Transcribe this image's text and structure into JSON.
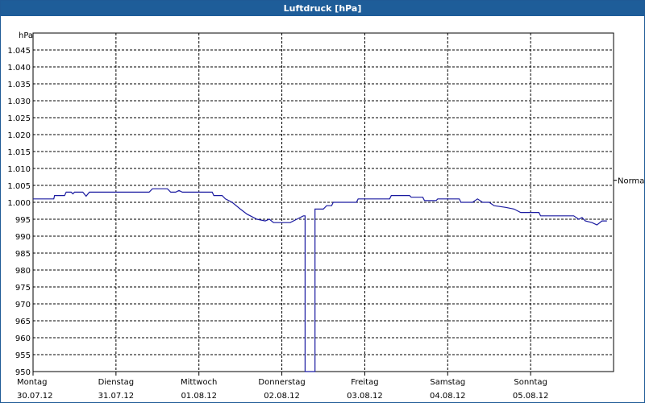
{
  "window": {
    "title": "Luftdruck [hPa]"
  },
  "chart_data": {
    "type": "line",
    "title": "Luftdruck [hPa]",
    "ylabel": "hPa",
    "ylim": [
      950,
      1050
    ],
    "yticks": [
      950,
      955,
      960,
      965,
      970,
      975,
      980,
      985,
      990,
      995,
      1000,
      1005,
      1010,
      1015,
      1020,
      1025,
      1030,
      1035,
      1040,
      1045
    ],
    "ytick_labels": [
      "950",
      "955",
      "960",
      "965",
      "970",
      "975",
      "980",
      "985",
      "990",
      "995",
      "1.000",
      "1.005",
      "1.010",
      "1.015",
      "1.020",
      "1.025",
      "1.030",
      "1.035",
      "1.040",
      "1.045"
    ],
    "xlim": [
      0,
      7
    ],
    "xticks": [
      0,
      1,
      2,
      3,
      4,
      5,
      6,
      7
    ],
    "xtick_labels": [
      {
        "day": "Montag",
        "date": "30.07.12"
      },
      {
        "day": "Dienstag",
        "date": "31.07.12"
      },
      {
        "day": "Mittwoch",
        "date": "01.08.12"
      },
      {
        "day": "Donnerstag",
        "date": "02.08.12"
      },
      {
        "day": "Freitag",
        "date": "03.08.12"
      },
      {
        "day": "Samstag",
        "date": "04.08.12"
      },
      {
        "day": "Sonntag",
        "date": "05.08.12"
      }
    ],
    "reference_line": {
      "label": "Normal",
      "value": 1006.5
    },
    "grid": true,
    "series": [
      {
        "color": "#1a1aa0",
        "points": [
          [
            0.0,
            1001
          ],
          [
            0.25,
            1001
          ],
          [
            0.26,
            1002
          ],
          [
            0.38,
            1002
          ],
          [
            0.4,
            1003
          ],
          [
            0.46,
            1003
          ],
          [
            0.48,
            1002.5
          ],
          [
            0.5,
            1003
          ],
          [
            0.6,
            1003
          ],
          [
            0.64,
            1001.8
          ],
          [
            0.68,
            1003
          ],
          [
            1.0,
            1003
          ],
          [
            1.4,
            1003
          ],
          [
            1.44,
            1004
          ],
          [
            1.62,
            1004
          ],
          [
            1.66,
            1003
          ],
          [
            1.72,
            1003
          ],
          [
            1.76,
            1003.5
          ],
          [
            1.8,
            1003
          ],
          [
            2.0,
            1003
          ],
          [
            2.16,
            1003
          ],
          [
            2.18,
            1002
          ],
          [
            2.28,
            1002
          ],
          [
            2.32,
            1001
          ],
          [
            2.4,
            1000
          ],
          [
            2.5,
            998
          ],
          [
            2.58,
            996.5
          ],
          [
            2.7,
            995
          ],
          [
            2.8,
            994.5
          ],
          [
            2.85,
            995
          ],
          [
            2.9,
            994
          ],
          [
            3.0,
            994
          ],
          [
            3.1,
            994
          ],
          [
            3.18,
            995
          ],
          [
            3.26,
            996
          ],
          [
            3.28,
            996
          ],
          [
            3.28,
            950
          ],
          [
            3.4,
            950
          ],
          [
            3.4,
            998
          ],
          [
            3.5,
            998
          ],
          [
            3.54,
            999
          ],
          [
            3.6,
            999
          ],
          [
            3.62,
            1000
          ],
          [
            3.9,
            1000
          ],
          [
            3.92,
            1001
          ],
          [
            4.0,
            1001
          ],
          [
            4.3,
            1001
          ],
          [
            4.32,
            1002
          ],
          [
            4.54,
            1002
          ],
          [
            4.56,
            1001.5
          ],
          [
            4.7,
            1001.5
          ],
          [
            4.72,
            1000.5
          ],
          [
            4.86,
            1000.5
          ],
          [
            4.88,
            1001
          ],
          [
            5.0,
            1001
          ],
          [
            5.14,
            1001
          ],
          [
            5.16,
            1000
          ],
          [
            5.3,
            1000
          ],
          [
            5.36,
            1001
          ],
          [
            5.42,
            1000
          ],
          [
            5.5,
            1000
          ],
          [
            5.56,
            999
          ],
          [
            5.7,
            998.5
          ],
          [
            5.8,
            998
          ],
          [
            5.88,
            997
          ],
          [
            5.96,
            997
          ],
          [
            6.0,
            997
          ],
          [
            6.1,
            997
          ],
          [
            6.12,
            996
          ],
          [
            6.52,
            996
          ],
          [
            6.58,
            995
          ],
          [
            6.62,
            995.5
          ],
          [
            6.66,
            994.5
          ],
          [
            6.74,
            994
          ],
          [
            6.8,
            993.3
          ],
          [
            6.86,
            994.5
          ],
          [
            6.92,
            994.5
          ]
        ]
      }
    ]
  }
}
